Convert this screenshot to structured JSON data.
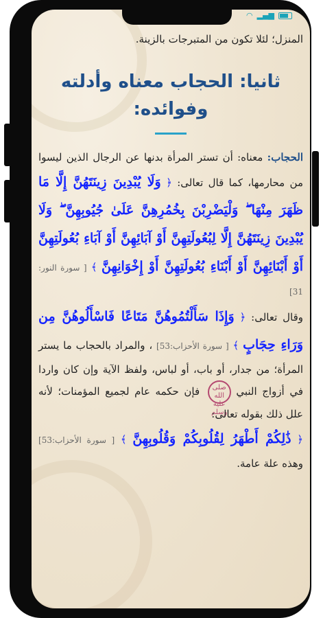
{
  "prev_line": "المنزل؛ لئلا تكون من المتبرجات بالزينة.",
  "section_title": "ثانيا: الحجاب معناه وأدلته وفوائده:",
  "para1": {
    "term": "الحجاب:",
    "text": " معناه: أن تستر المرأة بدنها عن الرجال الذين ليسوا من محارمها، كما قال تعالى: ",
    "open_bracket": "﴿",
    "quran": "وَلَا يُبْدِينَ زِينَتَهُنَّ إِلَّا مَا ظَهَرَ مِنْهَا ۖ وَلْيَضْرِبْنَ بِخُمُرِهِنَّ عَلَىٰ جُيُوبِهِنَّ ۖ وَلَا يُبْدِينَ زِينَتَهُنَّ إِلَّا لِبُعُولَتِهِنَّ أَوْ آبَائِهِنَّ أَوْ آبَاءِ بُعُولَتِهِنَّ أَوْ أَبْنَائِهِنَّ أَوْ أَبْنَاءِ بُعُولَتِهِنَّ أَوْ إِخْوَانِهِنَّ",
    "close_bracket": "﴾",
    "ref": "[ سورة النور: 31]"
  },
  "para2": {
    "lead": "وقال تعالى: ",
    "open_bracket": "﴿",
    "quran": "وَإِذَا سَأَلْتُمُوهُنَّ مَتَاعًا فَاسْأَلُوهُنَّ مِن وَرَاءِ حِجَابٍ",
    "close_bracket": "﴾",
    "ref": "[ سورة الأحزاب:53]",
    "text": " ، والمراد بالحجاب ما يستر المرأة؛ من جدار، أو باب، أو لباس، ولفظ الآية وإن كان واردا في أزواج النبي",
    "saw": "صلى الله عليه وسلم",
    "text2": " فإن حكمه عام لجميع المؤمنات؛ لأنه علل ذلك بقوله تعالى: "
  },
  "para3": {
    "open_bracket": "﴿",
    "quran": "ذَٰلِكُمْ أَطْهَرُ لِقُلُوبِكُمْ وَقُلُوبِهِنَّ",
    "close_bracket": "﴾",
    "ref": "[ سورة الأحزاب:53]",
    "text": " وهذه علة عامة."
  }
}
